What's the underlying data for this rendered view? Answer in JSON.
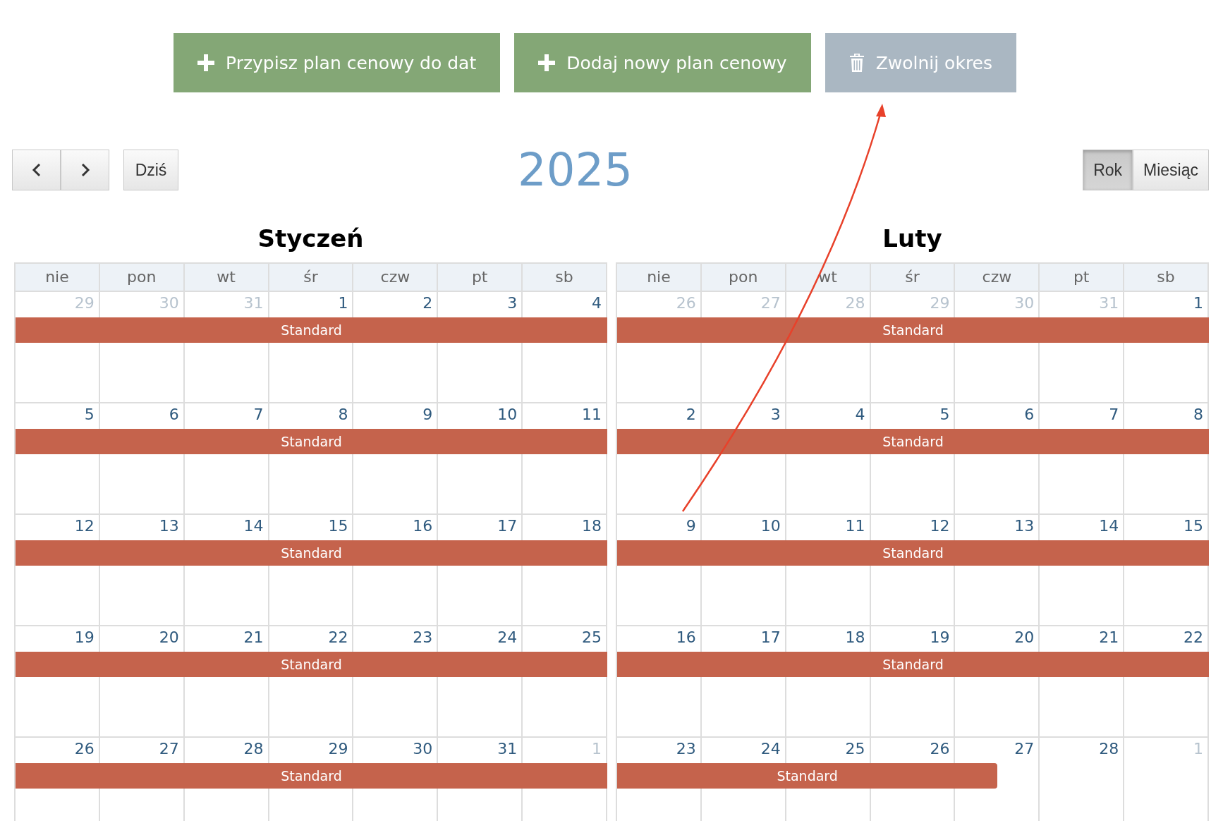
{
  "actions": [
    {
      "kind": "plus",
      "label": "Przypisz plan cenowy do dat",
      "disabled": false
    },
    {
      "kind": "plus",
      "label": "Dodaj nowy plan cenowy",
      "disabled": false
    },
    {
      "kind": "trash",
      "label": "Zwolnij okres",
      "disabled": true
    }
  ],
  "toolbar": {
    "today": "Dziś",
    "title": "2025",
    "views": [
      {
        "label": "Rok",
        "selected": true
      },
      {
        "label": "Miesiąc",
        "selected": false
      }
    ]
  },
  "months": [
    {
      "title": "Styczeń",
      "weekdays": [
        "nie",
        "pon",
        "wt",
        "śr",
        "czw",
        "pt",
        "sb"
      ],
      "weeks": [
        {
          "bar_label": "Standard",
          "days": [
            {
              "number": "29",
              "out": true,
              "planned": true
            },
            {
              "number": "30",
              "out": true,
              "planned": true
            },
            {
              "number": "31",
              "out": true,
              "planned": true
            },
            {
              "number": "1",
              "out": false,
              "planned": true
            },
            {
              "number": "2",
              "out": false,
              "planned": true
            },
            {
              "number": "3",
              "out": false,
              "planned": true
            },
            {
              "number": "4",
              "out": false,
              "planned": true
            }
          ]
        },
        {
          "bar_label": "Standard",
          "days": [
            {
              "number": "5",
              "out": false,
              "planned": true
            },
            {
              "number": "6",
              "out": false,
              "planned": true
            },
            {
              "number": "7",
              "out": false,
              "planned": true
            },
            {
              "number": "8",
              "out": false,
              "planned": true
            },
            {
              "number": "9",
              "out": false,
              "planned": true
            },
            {
              "number": "10",
              "out": false,
              "planned": true
            },
            {
              "number": "11",
              "out": false,
              "planned": true
            }
          ]
        },
        {
          "bar_label": "Standard",
          "days": [
            {
              "number": "12",
              "out": false,
              "planned": true
            },
            {
              "number": "13",
              "out": false,
              "planned": true
            },
            {
              "number": "14",
              "out": false,
              "planned": true
            },
            {
              "number": "15",
              "out": false,
              "planned": true
            },
            {
              "number": "16",
              "out": false,
              "planned": true
            },
            {
              "number": "17",
              "out": false,
              "planned": true
            },
            {
              "number": "18",
              "out": false,
              "planned": true
            }
          ]
        },
        {
          "bar_label": "Standard",
          "days": [
            {
              "number": "19",
              "out": false,
              "planned": true
            },
            {
              "number": "20",
              "out": false,
              "planned": true
            },
            {
              "number": "21",
              "out": false,
              "planned": true
            },
            {
              "number": "22",
              "out": false,
              "planned": true
            },
            {
              "number": "23",
              "out": false,
              "planned": true
            },
            {
              "number": "24",
              "out": false,
              "planned": true
            },
            {
              "number": "25",
              "out": false,
              "planned": true
            }
          ]
        },
        {
          "bar_label": "Standard",
          "days": [
            {
              "number": "26",
              "out": false,
              "planned": true
            },
            {
              "number": "27",
              "out": false,
              "planned": true
            },
            {
              "number": "28",
              "out": false,
              "planned": true
            },
            {
              "number": "29",
              "out": false,
              "planned": true
            },
            {
              "number": "30",
              "out": false,
              "planned": true
            },
            {
              "number": "31",
              "out": false,
              "planned": true
            },
            {
              "number": "1",
              "out": true,
              "planned": true
            }
          ]
        }
      ]
    },
    {
      "title": "Luty",
      "weekdays": [
        "nie",
        "pon",
        "wt",
        "śr",
        "czw",
        "pt",
        "sb"
      ],
      "weeks": [
        {
          "bar_label": "Standard",
          "days": [
            {
              "number": "26",
              "out": true,
              "planned": true
            },
            {
              "number": "27",
              "out": true,
              "planned": true
            },
            {
              "number": "28",
              "out": true,
              "planned": true
            },
            {
              "number": "29",
              "out": true,
              "planned": true
            },
            {
              "number": "30",
              "out": true,
              "planned": true
            },
            {
              "number": "31",
              "out": true,
              "planned": true
            },
            {
              "number": "1",
              "out": false,
              "planned": true
            }
          ]
        },
        {
          "bar_label": "Standard",
          "days": [
            {
              "number": "2",
              "out": false,
              "planned": true
            },
            {
              "number": "3",
              "out": false,
              "planned": true
            },
            {
              "number": "4",
              "out": false,
              "planned": true
            },
            {
              "number": "5",
              "out": false,
              "planned": true
            },
            {
              "number": "6",
              "out": false,
              "planned": true
            },
            {
              "number": "7",
              "out": false,
              "planned": true
            },
            {
              "number": "8",
              "out": false,
              "planned": true
            }
          ]
        },
        {
          "bar_label": "Standard",
          "days": [
            {
              "number": "9",
              "out": false,
              "planned": true
            },
            {
              "number": "10",
              "out": false,
              "planned": true
            },
            {
              "number": "11",
              "out": false,
              "planned": true
            },
            {
              "number": "12",
              "out": false,
              "planned": true
            },
            {
              "number": "13",
              "out": false,
              "planned": true
            },
            {
              "number": "14",
              "out": false,
              "planned": true
            },
            {
              "number": "15",
              "out": false,
              "planned": true
            }
          ]
        },
        {
          "bar_label": "Standard",
          "days": [
            {
              "number": "16",
              "out": false,
              "planned": true
            },
            {
              "number": "17",
              "out": false,
              "planned": true
            },
            {
              "number": "18",
              "out": false,
              "planned": true
            },
            {
              "number": "19",
              "out": false,
              "planned": true
            },
            {
              "number": "20",
              "out": false,
              "planned": true
            },
            {
              "number": "21",
              "out": false,
              "planned": true
            },
            {
              "number": "22",
              "out": false,
              "planned": true
            }
          ]
        },
        {
          "bar_label": "Standard",
          "days": [
            {
              "number": "23",
              "out": false,
              "planned": true
            },
            {
              "number": "24",
              "out": false,
              "planned": true
            },
            {
              "number": "25",
              "out": false,
              "planned": true
            },
            {
              "number": "26",
              "out": false,
              "planned": true
            },
            {
              "number": "27",
              "out": false,
              "planned": false
            },
            {
              "number": "28",
              "out": false,
              "planned": false
            },
            {
              "number": "1",
              "out": true,
              "planned": false
            }
          ]
        }
      ]
    }
  ],
  "annotations": [
    {
      "kind": "arrow"
    }
  ]
}
